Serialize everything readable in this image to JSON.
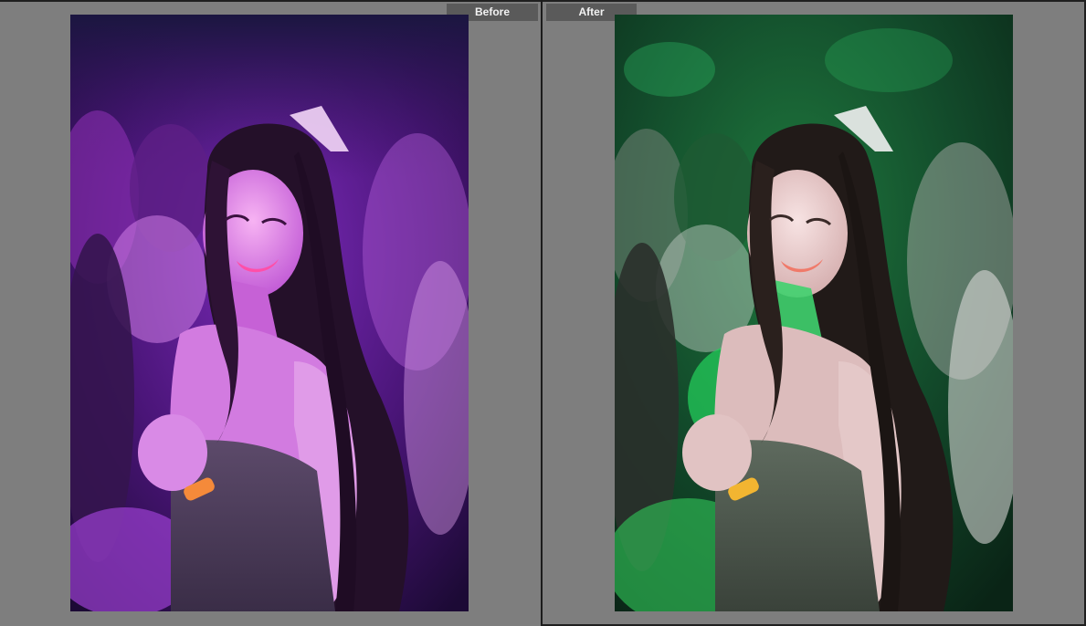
{
  "labels": {
    "before": "Before",
    "after": "After"
  },
  "images": {
    "before": {
      "description_tone": "purple-magenta"
    },
    "after": {
      "description_tone": "green-teal"
    }
  },
  "colors": {
    "background": "#7d7d7d",
    "label_tab": "#5a5a5a",
    "label_text": "#f2f2f2",
    "divider": "#1c1c1c"
  }
}
